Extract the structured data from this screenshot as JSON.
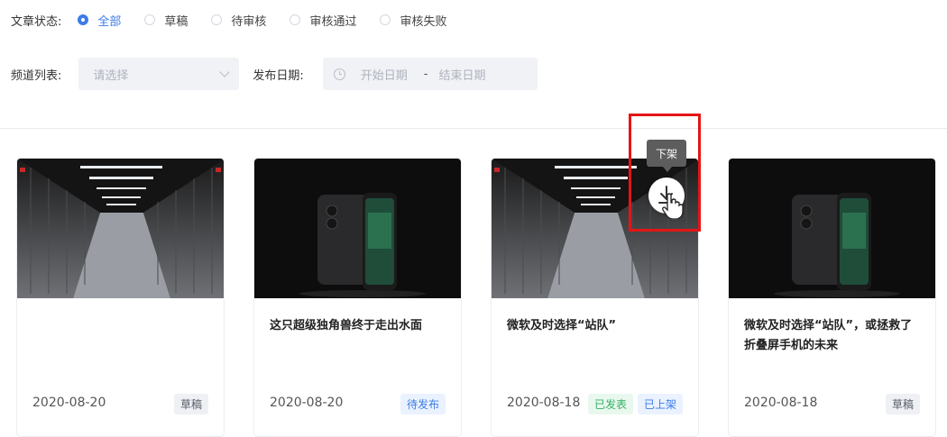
{
  "filters": {
    "status_label": "文章状态:",
    "status_options": [
      {
        "label": "全部",
        "selected": true
      },
      {
        "label": "草稿",
        "selected": false
      },
      {
        "label": "待审核",
        "selected": false
      },
      {
        "label": "审核通过",
        "selected": false
      },
      {
        "label": "审核失败",
        "selected": false
      }
    ],
    "channel_label": "频道列表:",
    "channel_placeholder": "请选择",
    "date_label": "发布日期:",
    "date_start_placeholder": "开始日期",
    "date_separator": "-",
    "date_end_placeholder": "结束日期"
  },
  "cards": [
    {
      "image": "server-room",
      "title": "",
      "date": "2020-08-20",
      "tags": [
        {
          "text": "草稿",
          "kind": "draft"
        }
      ]
    },
    {
      "image": "phone",
      "title": "这只超级独角兽终于走出水面",
      "date": "2020-08-20",
      "tags": [
        {
          "text": "待发布",
          "kind": "pending"
        }
      ]
    },
    {
      "image": "server-room",
      "title": "微软及时选择“站队”",
      "date": "2020-08-18",
      "tags": [
        {
          "text": "已发表",
          "kind": "published"
        },
        {
          "text": "已上架",
          "kind": "listed"
        }
      ]
    },
    {
      "image": "phone",
      "title": "微软及时选择“站队”，或拯救了折叠屏手机的未来",
      "date": "2020-08-18",
      "tags": [
        {
          "text": "草稿",
          "kind": "draft"
        }
      ]
    }
  ],
  "overlay": {
    "tooltip": "下架",
    "button_icon": "download-icon",
    "highlight_color": "#e41515"
  },
  "colors": {
    "accent": "#3d7be8",
    "published": "#36b265"
  }
}
